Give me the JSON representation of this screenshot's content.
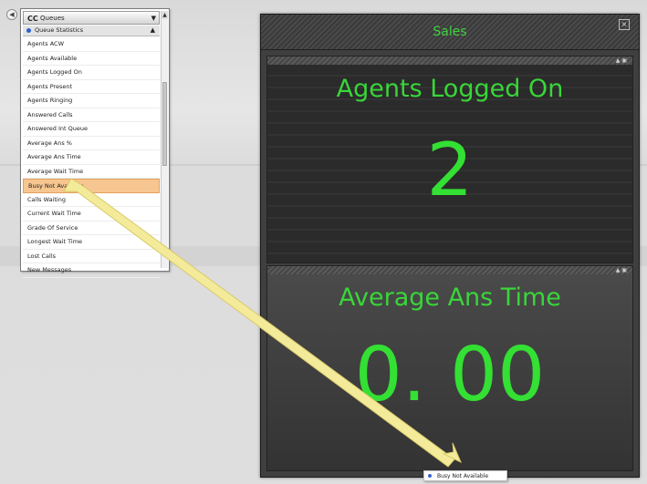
{
  "picker": {
    "header": "Queues",
    "header_icon": "CC",
    "section": "Queue Statistics",
    "items": [
      {
        "label": "Agents ACW"
      },
      {
        "label": "Agents Available"
      },
      {
        "label": "Agents Logged On"
      },
      {
        "label": "Agents Present"
      },
      {
        "label": "Agents Ringing"
      },
      {
        "label": "Answered Calls"
      },
      {
        "label": "Answered Int Queue"
      },
      {
        "label": "Average Ans %"
      },
      {
        "label": "Average Ans Time"
      },
      {
        "label": "Average Wait Time"
      },
      {
        "label": "Busy Not Available",
        "selected": true
      },
      {
        "label": "Calls Waiting"
      },
      {
        "label": "Current Wait Time"
      },
      {
        "label": "Grade Of Service"
      },
      {
        "label": "Longest Wait Time"
      },
      {
        "label": "Lost Calls"
      },
      {
        "label": "New Messages"
      }
    ]
  },
  "panel": {
    "title": "Sales",
    "tiles": [
      {
        "label": "Agents Logged On",
        "value": "2"
      },
      {
        "label": "Average Ans Time",
        "value": "0. 00"
      }
    ]
  },
  "drag_item": {
    "label": "Busy Not Available"
  },
  "colors": {
    "accent_green": "#39d639",
    "selected_row": "#f7c690",
    "arrow": "#f4eb9a"
  }
}
